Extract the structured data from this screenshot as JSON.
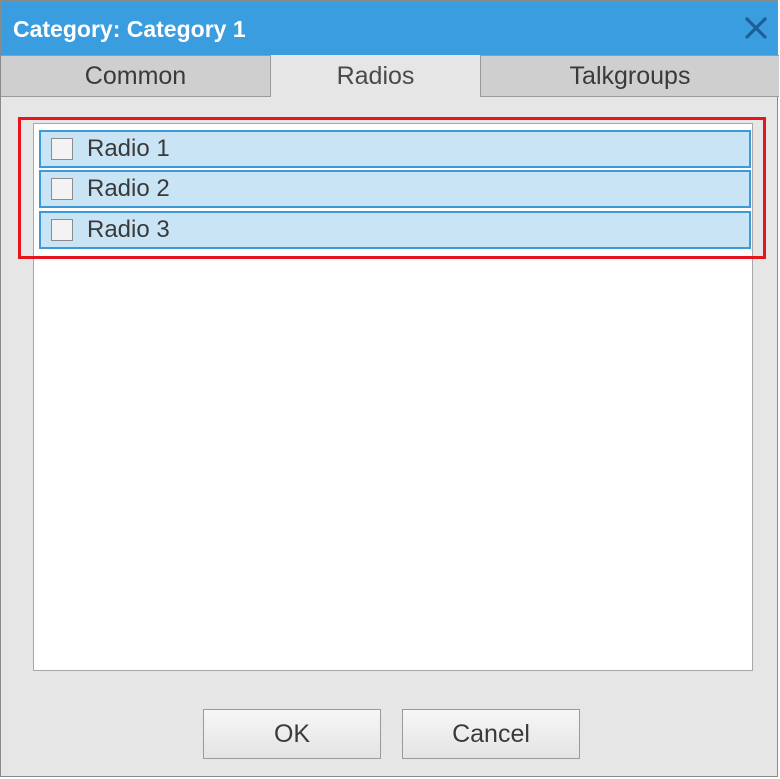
{
  "dialog": {
    "title": "Category: Category 1",
    "close_icon": "close-icon",
    "colors": {
      "titlebar": "#3a9de0",
      "selection": "#c9e4f5",
      "selection_border": "#3d9ad6",
      "highlight": "#e8141c"
    }
  },
  "tabs": [
    {
      "label": "Common",
      "active": false
    },
    {
      "label": "Radios",
      "active": true
    },
    {
      "label": "Talkgroups",
      "active": false
    }
  ],
  "radios": [
    {
      "label": "Radio 1",
      "checked": false
    },
    {
      "label": "Radio 2",
      "checked": false
    },
    {
      "label": "Radio 3",
      "checked": false
    }
  ],
  "buttons": {
    "ok": "OK",
    "cancel": "Cancel"
  }
}
